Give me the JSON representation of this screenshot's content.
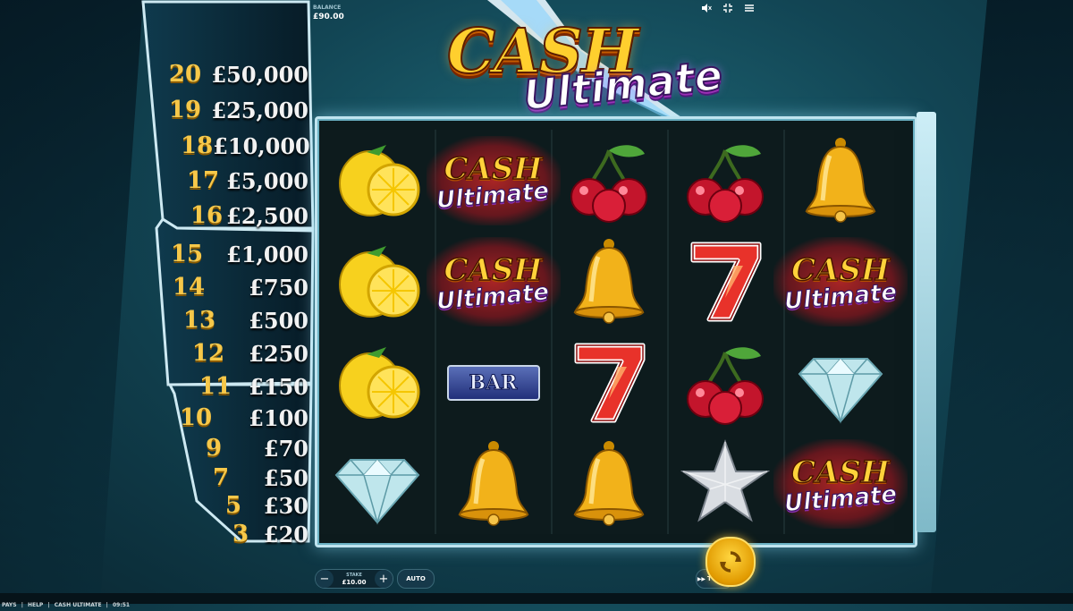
{
  "header": {
    "balance_label": "BALANCE",
    "balance_value": "£90.00"
  },
  "top_icons": [
    "mute-icon",
    "fullscreen-icon",
    "menu-icon"
  ],
  "logo": {
    "line1": "CASH",
    "line2": "Ultimate"
  },
  "paytable": [
    {
      "count": "20",
      "prize": "£50,000"
    },
    {
      "count": "19",
      "prize": "£25,000"
    },
    {
      "count": "18",
      "prize": "£10,000"
    },
    {
      "count": "17",
      "prize": "£5,000"
    },
    {
      "count": "16",
      "prize": "£2,500"
    },
    {
      "count": "15",
      "prize": "£1,000"
    },
    {
      "count": "14",
      "prize": "£750"
    },
    {
      "count": "13",
      "prize": "£500"
    },
    {
      "count": "12",
      "prize": "£250"
    },
    {
      "count": "11",
      "prize": "£150"
    },
    {
      "count": "10",
      "prize": "£100"
    },
    {
      "count": "9",
      "prize": "£70"
    },
    {
      "count": "7",
      "prize": "£50"
    },
    {
      "count": "5",
      "prize": "£30"
    },
    {
      "count": "3",
      "prize": "£20"
    }
  ],
  "reels": [
    [
      "lemon",
      "cash-ultimate",
      "cherry",
      "cherry",
      "bell"
    ],
    [
      "lemon",
      "cash-ultimate",
      "bell",
      "seven",
      "cash-ultimate"
    ],
    [
      "lemon",
      "bar",
      "seven",
      "cherry",
      "diamond"
    ],
    [
      "diamond",
      "bell",
      "bell",
      "star",
      "cash-ultimate"
    ]
  ],
  "symbol_text": {
    "cash": "CASH",
    "ultimate": "Ultimate",
    "bar": "BAR"
  },
  "controls": {
    "minus": "−",
    "plus": "+",
    "stake_label": "STAKE",
    "stake_value": "£10.00",
    "auto_label": "AUTO",
    "turbo_label": "TURBO"
  },
  "footer": {
    "pays": "PAYS",
    "help": "HELP",
    "game": "CASH ULTIMATE",
    "time": "09:51"
  },
  "colors": {
    "gold": "#f6c84a",
    "accent": "#ffcf2e",
    "frame": "#bfe4ef"
  }
}
